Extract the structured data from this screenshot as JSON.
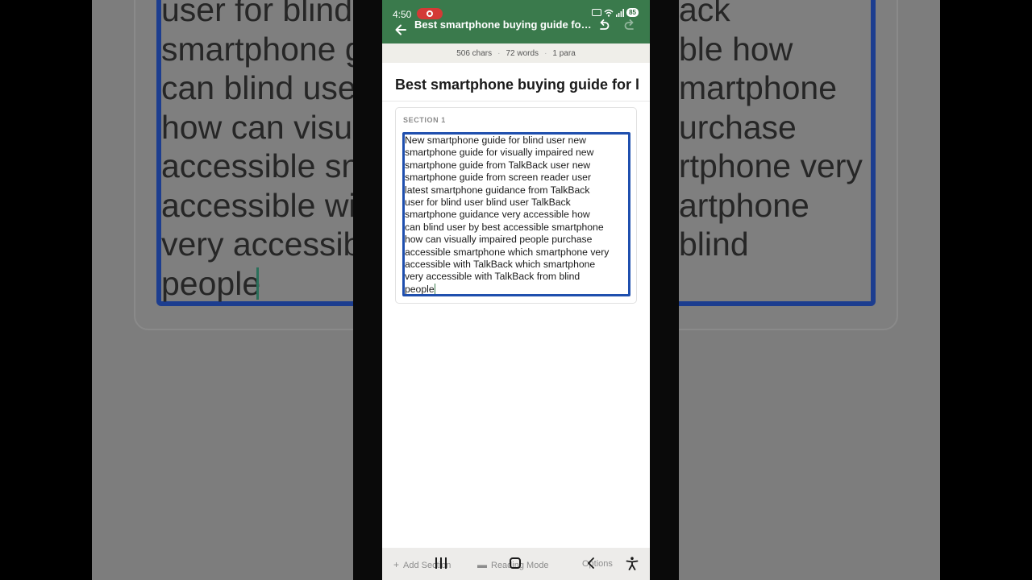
{
  "background": {
    "left_text_lines": [
      "user for blind",
      "smartphone gu",
      "can blind use",
      "how can visu",
      "accessible sn",
      "accessible wi",
      "very accessib",
      "people"
    ],
    "right_text_lines": [
      "ack",
      "ble how",
      "martphone",
      "urchase",
      "rtphone very",
      "artphone",
      "blind",
      ""
    ]
  },
  "status_bar": {
    "time": "4:50",
    "battery": "85"
  },
  "app_bar": {
    "title": "Best smartphone buying guide for b..."
  },
  "stats": {
    "chars": "506 chars",
    "words": "72 words",
    "paras": "1 para",
    "separator": "·"
  },
  "document": {
    "title": "Best smartphone buying guide for l",
    "section_label": "SECTION 1",
    "section_lines": [
      "New smartphone guide for blind user new",
      "smartphone guide for visually impaired new",
      "smartphone guide from TalkBack user new",
      "smartphone guide from screen reader user",
      "latest smartphone guidance from TalkBack",
      "user for blind user blind user TalkBack",
      "smartphone guidance very accessible how",
      "can blind user by best accessible smartphone",
      "how can visually impaired people purchase",
      "accessible smartphone which smartphone very",
      "accessible with TalkBack which smartphone",
      "very accessible with TalkBack from blind",
      "people"
    ]
  },
  "toolbar": {
    "add_section": "Add Section",
    "reading_mode": "Reading Mode",
    "options": "Options"
  },
  "colors": {
    "app_bar": "#3a7a4c",
    "textarea_border": "#1f4fae",
    "recording": "#d43a36"
  }
}
